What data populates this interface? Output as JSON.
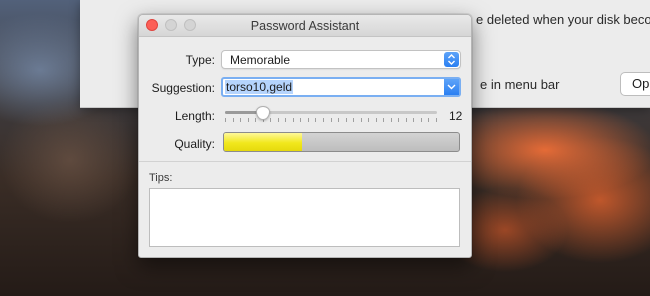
{
  "background_window": {
    "top_text": "e deleted when your disk become",
    "menu_bar_text": "e in menu bar",
    "button_label": "Op"
  },
  "panel": {
    "title": "Password Assistant",
    "type_label": "Type:",
    "type_value": "Memorable",
    "suggestion_label": "Suggestion:",
    "suggestion_value": "torso10,geld",
    "length_label": "Length:",
    "length_value": "12",
    "length_fraction": 0.18,
    "quality_label": "Quality:",
    "quality_fraction": 0.33,
    "quality_color": "#f1e81c",
    "tips_label": "Tips:",
    "tips_text": ""
  }
}
